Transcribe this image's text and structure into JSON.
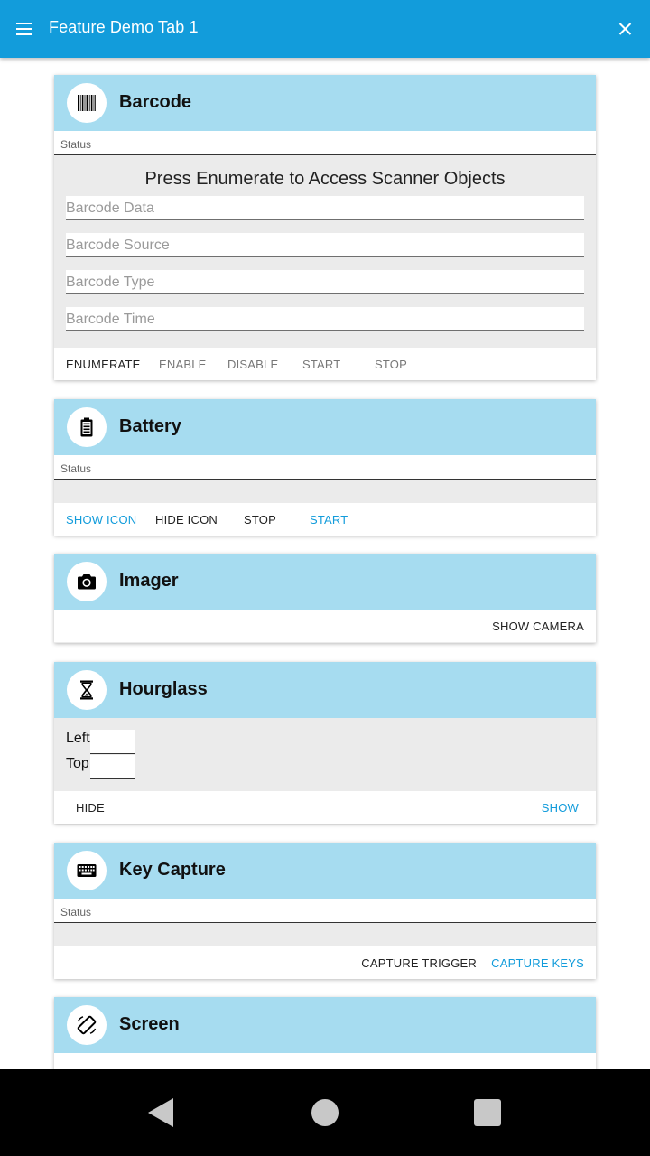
{
  "app_bar": {
    "title": "Feature Demo Tab 1",
    "menu_icon": "hamburger-menu-icon",
    "close_icon": "close-icon",
    "color": "#129cdb"
  },
  "theme": {
    "card_header_color": "#a6dcf0",
    "card_body_color": "#ebebeb",
    "accent_color": "#129cdb"
  },
  "barcode": {
    "title": "Barcode",
    "icon": "barcode-icon",
    "status_label": "Status",
    "message": "Press Enumerate to Access Scanner Objects",
    "fields": {
      "data_placeholder": "Barcode Data",
      "source_placeholder": "Barcode Source",
      "type_placeholder": "Barcode Type",
      "time_placeholder": "Barcode Time"
    },
    "buttons": {
      "enumerate": "ENUMERATE",
      "enable": "ENABLE",
      "disable": "DISABLE",
      "start": "START",
      "stop": "STOP"
    }
  },
  "battery": {
    "title": "Battery",
    "icon": "battery-icon",
    "status_label": "Status",
    "buttons": {
      "show_icon": "SHOW ICON",
      "hide_icon": "HIDE ICON",
      "stop": "STOP",
      "start": "START"
    }
  },
  "imager": {
    "title": "Imager",
    "icon": "camera-icon",
    "buttons": {
      "show_camera": "SHOW CAMERA"
    }
  },
  "hourglass": {
    "title": "Hourglass",
    "icon": "hourglass-icon",
    "left_label": "Left",
    "top_label": "Top",
    "buttons": {
      "hide": "HIDE",
      "show": "SHOW"
    }
  },
  "key_capture": {
    "title": "Key Capture",
    "icon": "keyboard-icon",
    "status_label": "Status",
    "buttons": {
      "capture_trigger": "CAPTURE TRIGGER",
      "capture_keys": "CAPTURE KEYS"
    }
  },
  "screen": {
    "title": "Screen",
    "icon": "screen-rotation-icon"
  },
  "nav_bar": {
    "back_icon": "back-icon",
    "home_icon": "home-icon",
    "recents_icon": "recents-icon"
  }
}
